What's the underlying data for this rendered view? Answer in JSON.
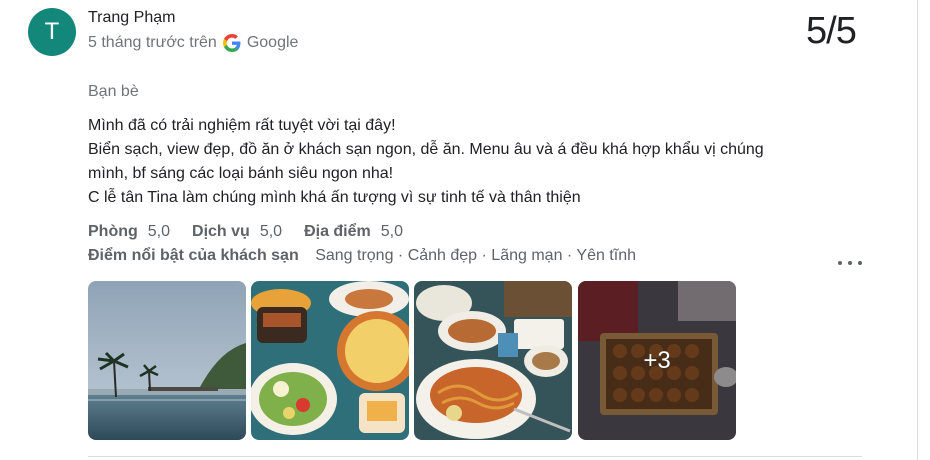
{
  "review": {
    "avatar_letter": "T",
    "avatar_color": "#12877a",
    "reviewer_name": "Trang Phạm",
    "time_ago": "5 tháng trước trên",
    "source": "Google",
    "score": "5/5",
    "trip_type": "Bạn bè",
    "text_lines": [
      "Mình đã có trải nghiệm rất tuyệt vời tại đây!",
      "Biển sạch, view đẹp, đồ ăn ở khách sạn ngon, dễ ăn. Menu âu và á đều khá hợp khẩu vị chúng",
      "mình, bf sáng các loại bánh siêu ngon nha!",
      "C lễ tân Tina làm chúng mình khá ấn tượng vì sự tinh tế và thân thiện"
    ],
    "ratings": [
      {
        "label": "Phòng",
        "value": "5,0"
      },
      {
        "label": "Dịch vụ",
        "value": "5,0"
      },
      {
        "label": "Địa điểm",
        "value": "5,0"
      }
    ],
    "highlights_label": "Điểm nổi bật của khách sạn",
    "highlights_value": "Sang trọng · Cảnh đẹp · Lãng mạn · Yên tĩnh",
    "photos": [
      {
        "icon": "beach-pool-photo"
      },
      {
        "icon": "food-table-photo"
      },
      {
        "icon": "spaghetti-photo"
      },
      {
        "icon": "pastry-box-photo",
        "overlay": "+3"
      }
    ]
  }
}
